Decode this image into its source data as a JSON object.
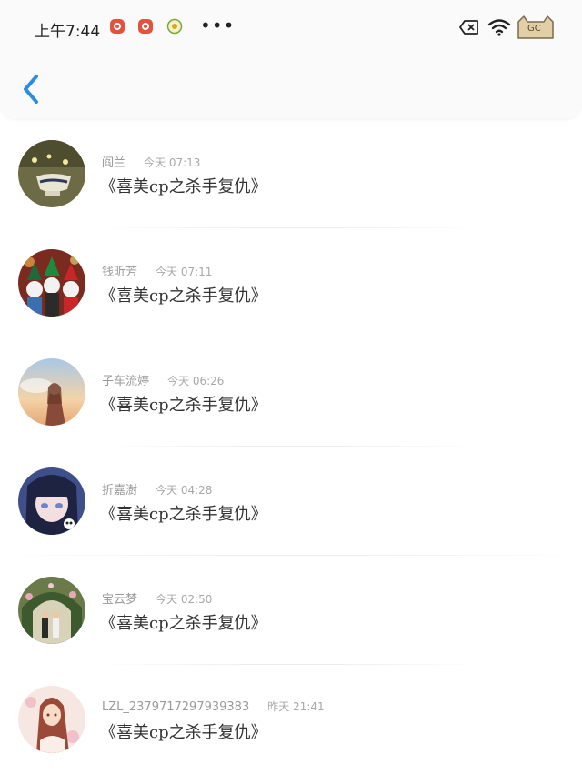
{
  "status_bar": {
    "time": "上午7:44",
    "more": "•••",
    "badge_text": "GC"
  },
  "messages": [
    {
      "name": "阎兰",
      "time": "今天 07:13",
      "title": "《喜美cp之杀手复仇》",
      "avatar_icon": "teacup-avatar-icon"
    },
    {
      "name": "钱昕芳",
      "time": "今天 07:11",
      "title": "《喜美cp之杀手复仇》",
      "avatar_icon": "snowmen-avatar-icon"
    },
    {
      "name": "子车流婷",
      "time": "今天 06:26",
      "title": "《喜美cp之杀手复仇》",
      "avatar_icon": "anime-girl-sunset-avatar-icon"
    },
    {
      "name": "折嘉澍",
      "time": "今天 04:28",
      "title": "《喜美cp之杀手复仇》",
      "avatar_icon": "anime-girl-blue-avatar-icon"
    },
    {
      "name": "宝云梦",
      "time": "今天 02:50",
      "title": "《喜美cp之杀手复仇》",
      "avatar_icon": "garden-couple-avatar-icon"
    },
    {
      "name": "LZL_2379717297939383",
      "time": "昨天 21:41",
      "title": "《喜美cp之杀手复仇》",
      "avatar_icon": "anime-girl-pink-avatar-icon"
    }
  ]
}
